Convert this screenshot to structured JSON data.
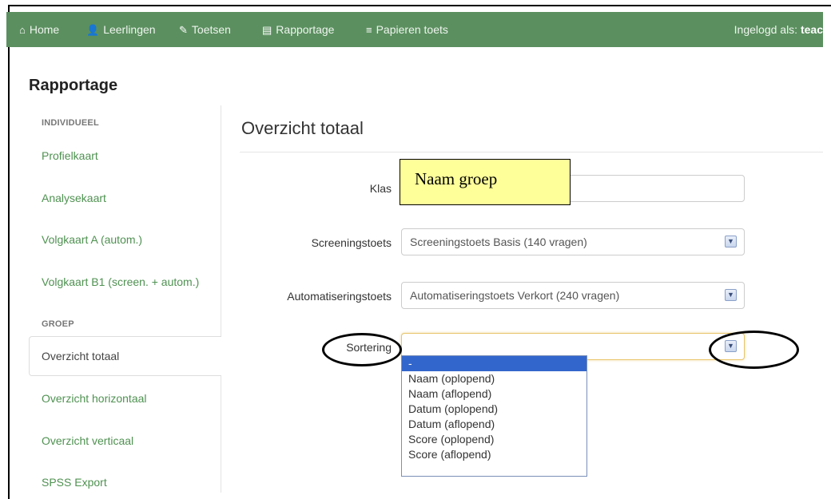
{
  "navbar": {
    "items": [
      {
        "icon": "home-icon",
        "glyph": "⌂",
        "label": "Home"
      },
      {
        "icon": "user-icon",
        "glyph": "👤",
        "label": "Leerlingen"
      },
      {
        "icon": "pencil-icon",
        "glyph": "✎",
        "label": "Toetsen"
      },
      {
        "icon": "report-icon",
        "glyph": "▤",
        "label": "Rapportage"
      },
      {
        "icon": "list-icon",
        "glyph": "≡",
        "label": "Papieren toets"
      }
    ],
    "login_prefix": "Ingelogd als: ",
    "login_user": "teac"
  },
  "page_title": "Rapportage",
  "sidebar": {
    "section_individual": "INDIVIDUEEL",
    "individual_items": [
      "Profielkaart",
      "Analysekaart",
      "Volgkaart A (autom.)",
      "Volgkaart B1 (screen. + autom.)"
    ],
    "section_group": "GROEP",
    "active_item": "Overzicht totaal",
    "group_items": [
      "Overzicht horizontaal",
      "Overzicht verticaal",
      "SPSS Export"
    ]
  },
  "content": {
    "title": "Overzicht totaal",
    "klas_label": "Klas",
    "klas_annotation": "Naam groep",
    "screening_label": "Screeningstoets",
    "screening_value": "Screeningstoets Basis (140 vragen)",
    "automatisering_label": "Automatiseringstoets",
    "automatisering_value": "Automatiseringstoets Verkort (240 vragen)",
    "sortering_label": "Sortering",
    "sortering_value": "",
    "sortering_options": [
      "-",
      "Naam (oplopend)",
      "Naam (aflopend)",
      "Datum (oplopend)",
      "Datum (aflopend)",
      "Score (oplopend)",
      "Score (aflopend)"
    ],
    "sortering_selected": "-"
  },
  "colors": {
    "navbar_bg": "#5b8f5f",
    "link_green": "#4f9151",
    "annotation_yellow": "#ffff99",
    "dropdown_highlight": "#3366cc"
  }
}
